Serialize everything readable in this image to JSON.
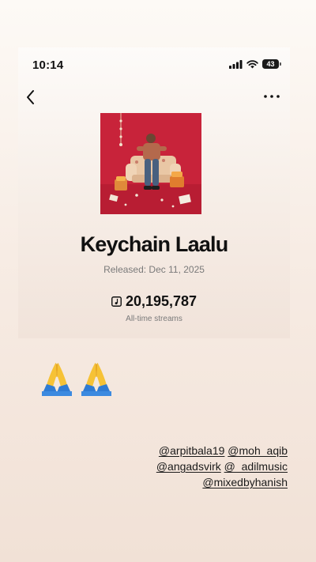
{
  "status_bar": {
    "time": "10:14",
    "battery": "43",
    "icons": [
      "cellular-signal-icon",
      "wifi-icon",
      "battery-icon"
    ]
  },
  "nav": {
    "back_icon": "chevron-left-icon",
    "more_icon": "more-horizontal-icon"
  },
  "track": {
    "title": "Keychain Laalu",
    "released": "Released: Dec 11, 2025",
    "streams": "20,195,787",
    "streams_label": "All-time streams",
    "streams_icon": "music-note-box-icon"
  },
  "story": {
    "emoji": [
      "🙏",
      "🙏"
    ],
    "mentions": [
      [
        "@arpitbala19",
        "@moh_aqib"
      ],
      [
        "@angadsvirk",
        "@_adilmusic"
      ],
      [
        "@mixedbyhanish"
      ]
    ]
  },
  "colors": {
    "album_red": "#c8233a",
    "text_primary": "#111111",
    "text_secondary": "#7a7a7a"
  }
}
